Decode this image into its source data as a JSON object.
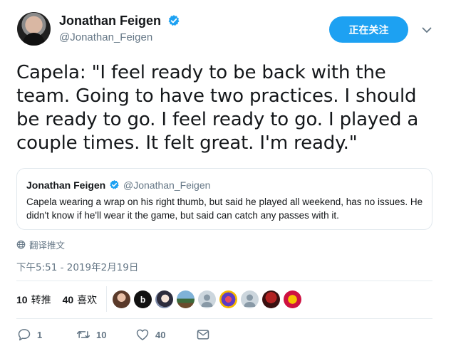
{
  "author": {
    "name": "Jonathan Feigen",
    "handle": "@Jonathan_Feigen",
    "follow_label": "正在关注"
  },
  "tweet": {
    "text": "Capela: \"I feel ready to be back with the team. Going to have two practices. I should be ready to go. I feel ready to go. I played a couple times. It felt great. I'm ready.\""
  },
  "quote": {
    "name": "Jonathan Feigen",
    "handle": "@Jonathan_Feigen",
    "text": "Capela wearing a wrap on his right thumb, but said he played all weekend, has no issues. He didn't know if he'll wear it the game, but said can catch any passes with it."
  },
  "translate_label": "翻译推文",
  "timestamp": "下午5:51 - 2019年2月19日",
  "stats": {
    "retweets_count": "10",
    "retweets_label": "转推",
    "likes_count": "40",
    "likes_label": "喜欢"
  },
  "likers": [
    {
      "icon": "avatar-woman"
    },
    {
      "icon": "avatar-b-logo"
    },
    {
      "icon": "avatar-anime"
    },
    {
      "icon": "avatar-landscape"
    },
    {
      "icon": "avatar-default-egg"
    },
    {
      "icon": "avatar-colorful"
    },
    {
      "icon": "avatar-default-egg"
    },
    {
      "icon": "avatar-red"
    },
    {
      "icon": "avatar-rockets-logo"
    }
  ],
  "actions": {
    "reply_count": "1",
    "retweet_count": "10",
    "like_count": "40"
  },
  "colors": {
    "accent": "#1da1f2",
    "text": "#14171a",
    "muted": "#657786",
    "border": "#e1e8ed"
  }
}
